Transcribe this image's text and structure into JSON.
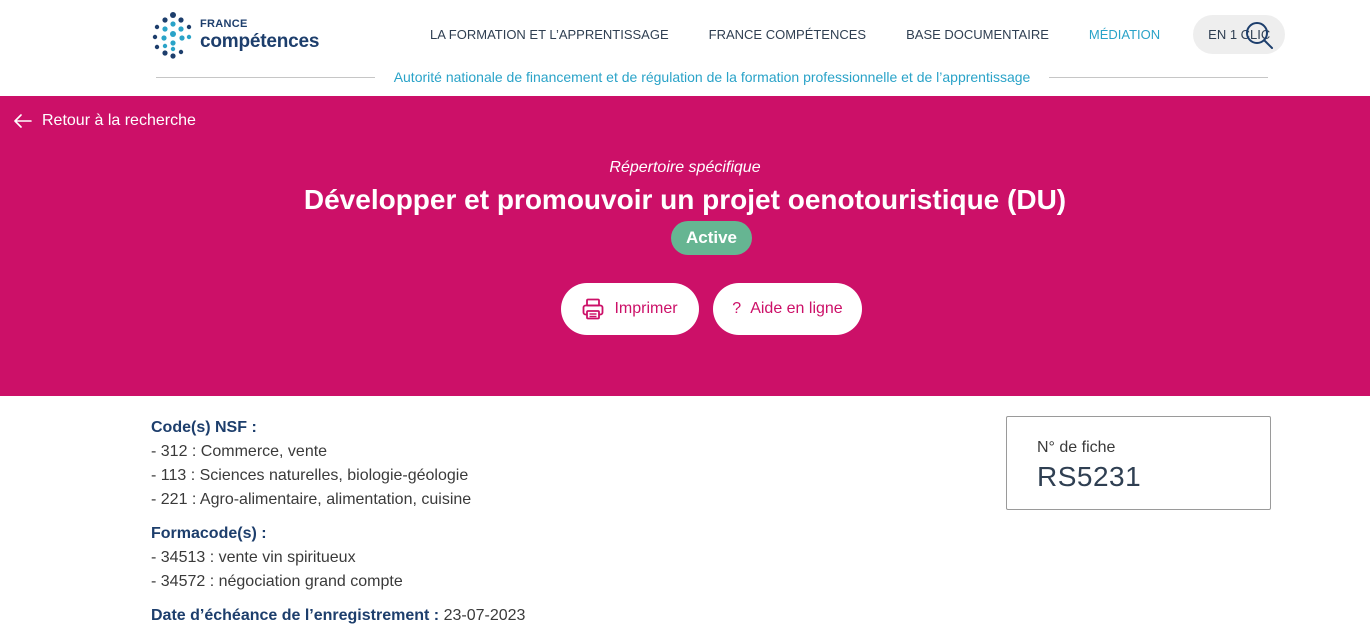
{
  "header": {
    "logo": {
      "small": "FRANCE",
      "big": "compétences"
    },
    "nav": [
      {
        "label": "LA FORMATION ET L’APPRENTISSAGE",
        "active": false
      },
      {
        "label": "FRANCE COMPÉTENCES",
        "active": false
      },
      {
        "label": "BASE DOCUMENTAIRE",
        "active": false
      },
      {
        "label": "MÉDIATION",
        "active": true
      }
    ],
    "quick_link": "EN 1 CLIC",
    "search_icon": "search-icon",
    "tagline": "Autorité nationale de financement et de régulation de la formation professionnelle et de l’apprentissage"
  },
  "banner": {
    "back_label": "Retour à la recherche",
    "subtitle": "Répertoire spécifique",
    "title": "Développer et promouvoir un projet oenotouristique (DU)",
    "status": "Active",
    "print_label": "Imprimer",
    "help_icon": "?",
    "help_label": "Aide en ligne"
  },
  "details": {
    "nsf_title": "Code(s) NSF :",
    "nsf_items": [
      "- 312 : Commerce, vente",
      "- 113 : Sciences naturelles, biologie-géologie",
      "- 221 : Agro-alimentaire, alimentation, cuisine"
    ],
    "formacode_title": "Formacode(s) :",
    "formacode_items": [
      "- 34513 : vente vin spiritueux",
      "- 34572 : négociation grand compte"
    ],
    "echeance_title": "Date d’échéance de l’enregistrement :",
    "echeance_value": "23-07-2023"
  },
  "fiche": {
    "label": "N° de fiche",
    "number": "RS5231"
  },
  "colors": {
    "banner": "#cc1068",
    "accent": "#2aa3c8",
    "status_active": "#66b592",
    "navy": "#1d3e6c"
  }
}
